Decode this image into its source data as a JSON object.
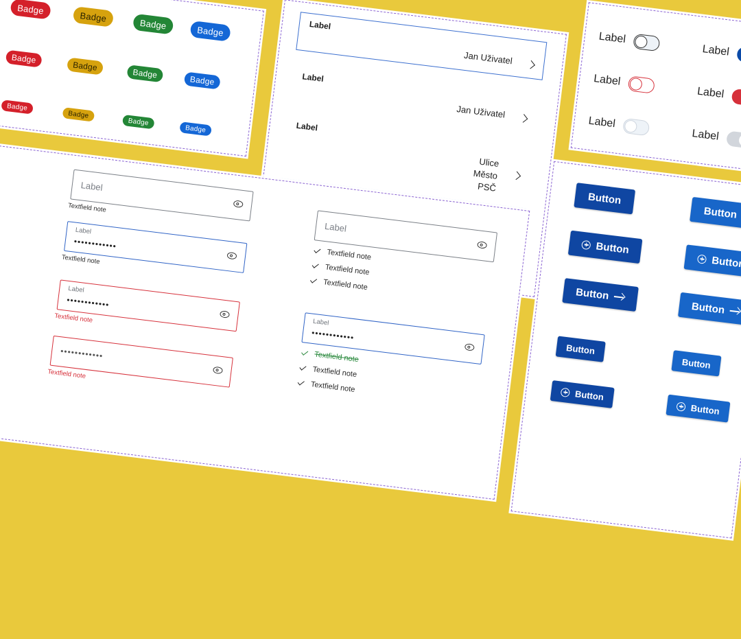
{
  "badges": {
    "label": "Badge"
  },
  "list": {
    "label": "Label",
    "user_value": "Jan Uživatel",
    "address_lines": [
      "Ulice",
      "Město",
      "PSČ"
    ]
  },
  "toggles": {
    "label": "Label"
  },
  "buttons": {
    "label": "Button"
  },
  "textfields": {
    "placeholder": "Label",
    "floating_label": "Label",
    "note": "Textfield note",
    "password_mask": "••••••••••••"
  },
  "colors": {
    "background": "#e9c93c",
    "badge_red": "#d4202a",
    "badge_yellow": "#d6a20e",
    "badge_green": "#238636",
    "badge_blue": "#1467d6",
    "primary_dark": "#0f46a2",
    "primary": "#1866c9",
    "error": "#d6303a",
    "success": "#2c8a3f"
  },
  "icons": [
    "chevron-right-icon",
    "plus-circle-icon",
    "arrow-right-icon",
    "eye-icon",
    "check-icon"
  ]
}
